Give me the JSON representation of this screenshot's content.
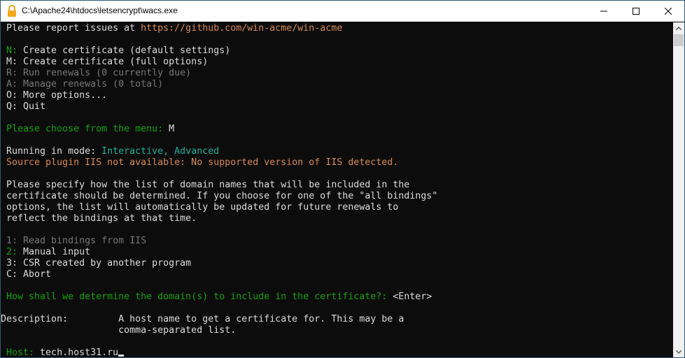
{
  "window": {
    "title": "C:\\Apache24\\htdocs\\letsencrypt\\wacs.exe"
  },
  "colors": {
    "white": "#dcdcdc",
    "green": "#13a10e",
    "gray": "#767676",
    "orange": "#d98a55",
    "teal": "#1cb09a"
  },
  "lines": [
    [
      {
        "t": " Please report issues at ",
        "c": "white"
      },
      {
        "t": "https://github.com/win-acme/win-acme",
        "c": "orange"
      }
    ],
    [],
    [
      {
        "t": " N: ",
        "c": "green"
      },
      {
        "t": "Create certificate (default settings)",
        "c": "white"
      }
    ],
    [
      {
        "t": " M: Create certificate (full options)",
        "c": "white"
      }
    ],
    [
      {
        "t": " R: Run renewals (0 currently due)",
        "c": "gray"
      }
    ],
    [
      {
        "t": " A: Manage renewals (0 total)",
        "c": "gray"
      }
    ],
    [
      {
        "t": " O: More options...",
        "c": "white"
      }
    ],
    [
      {
        "t": " Q: Quit",
        "c": "white"
      }
    ],
    [],
    [
      {
        "t": " Please choose from the menu: ",
        "c": "green"
      },
      {
        "t": "M",
        "c": "white"
      }
    ],
    [],
    [
      {
        "t": " Running in mode: ",
        "c": "white"
      },
      {
        "t": "Interactive, Advanced",
        "c": "teal"
      }
    ],
    [
      {
        "t": " Source plugin IIS not available: No supported version of IIS detected.",
        "c": "orange"
      }
    ],
    [],
    [
      {
        "t": " Please specify how the list of domain names that will be included in the",
        "c": "white"
      }
    ],
    [
      {
        "t": " certificate should be determined. If you choose for one of the \"all bindings\"",
        "c": "white"
      }
    ],
    [
      {
        "t": " options, the list will automatically be updated for future renewals to",
        "c": "white"
      }
    ],
    [
      {
        "t": " reflect the bindings at that time.",
        "c": "white"
      }
    ],
    [],
    [
      {
        "t": " 1: Read bindings from IIS",
        "c": "gray"
      }
    ],
    [
      {
        "t": " 2: ",
        "c": "green"
      },
      {
        "t": "Manual input",
        "c": "white"
      }
    ],
    [
      {
        "t": " 3: CSR created by another program",
        "c": "white"
      }
    ],
    [
      {
        "t": " C: Abort",
        "c": "white"
      }
    ],
    [],
    [
      {
        "t": " How shall we determine the domain(s) to include in the certificate?: ",
        "c": "green"
      },
      {
        "t": "<Enter>",
        "c": "white"
      }
    ],
    [],
    [
      {
        "t": "Description:         A host name to get a certificate for. This may be a",
        "c": "white"
      }
    ],
    [
      {
        "t": "                     comma-separated list.",
        "c": "white"
      }
    ],
    [],
    [
      {
        "t": " Host: ",
        "c": "green"
      },
      {
        "t": "tech.host31.ru",
        "c": "white"
      }
    ]
  ]
}
